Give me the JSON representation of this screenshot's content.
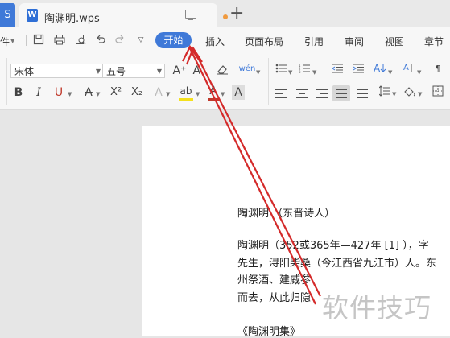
{
  "tabbar": {
    "left_tab_label": "S",
    "doc_icon_letter": "W",
    "doc_title": "陶渊明.wps",
    "add_label": "+"
  },
  "menu": {
    "left_label": "件",
    "start": "开始",
    "insert": "插入",
    "layout": "页面布局",
    "references": "引用",
    "review": "审阅",
    "view": "视图",
    "chapter": "章节"
  },
  "ribbon": {
    "font_name": "宋体",
    "font_size": "五号",
    "bold": "B",
    "italic": "I",
    "underline": "U",
    "strike": "A",
    "superscript": "X²",
    "subscript": "X₂",
    "text_effect": "A",
    "highlight": "ab",
    "font_color": "A",
    "char_shading": "A",
    "increase_font": "A⁺",
    "decrease_font": "A⁻",
    "pinyin": "wén",
    "brand_color": "#3f79d8"
  },
  "document": {
    "heading": "陶渊明 （东晋诗人）",
    "line1": "陶渊明（352或365年—427年 [1]   ），字",
    "line2": "先生，浔阳柴桑（今江西省九江市）人。东",
    "line3": "州祭酒、建威参",
    "line4": "而去，从此归隐",
    "collection": "《陶渊明集》"
  },
  "watermark": "软件技巧"
}
